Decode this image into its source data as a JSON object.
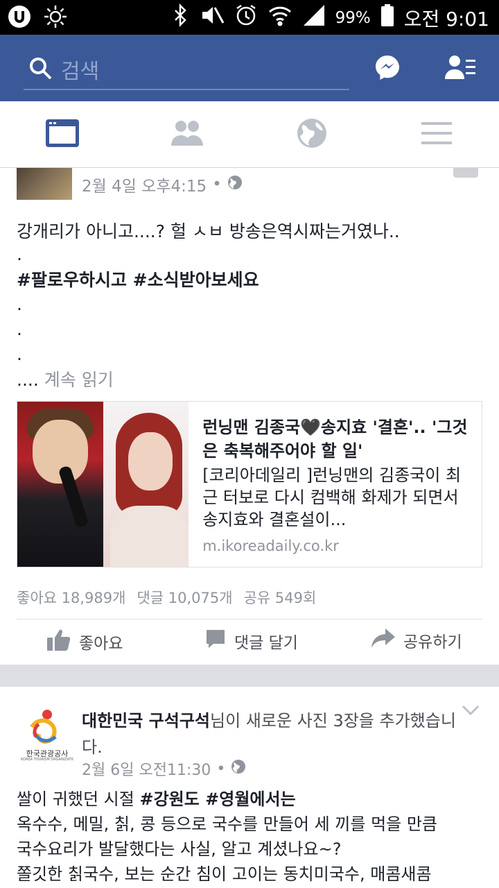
{
  "status_bar": {
    "battery": "99%",
    "time": "오전 9:01"
  },
  "header": {
    "search_placeholder": "검색"
  },
  "post1": {
    "time": "2월 4일 오후4:15",
    "line1": "강개리가 아니고....? 헐 ㅅㅂ 방송은역시짜는거였나..",
    "dot": ".",
    "hashtags": "#팔로우하시고 #소식받아보세요",
    "ellipsis": "....",
    "read_more": "계속 읽기",
    "link": {
      "title": "런닝맨 김종국🖤송지효 '결혼'.. '그것은 축복해주어야 할 일'",
      "description": "[코리아데일리 ]런닝맨의 김종국이 최근 터보로 다시 컴백해 화제가 되면서 송지효와 결혼설이...",
      "domain": "m.ikoreadaily.co.kr"
    },
    "likes": "좋아요 18,989개",
    "comments": "댓글 10,075개",
    "shares": "공유 549회",
    "like_label": "좋아요",
    "comment_label": "댓글 달기",
    "share_label": "공유하기"
  },
  "post2": {
    "page_name": "대한민국 구석구석",
    "action_text": "님이 새로운 사진 3장을 추가했습니다.",
    "logo_text": "한국관광공사",
    "logo_subtext": "KOREA TOURISM ORGANIZATION",
    "time": "2월 6일 오전11:30",
    "text_line1_a": "쌀이 귀했던 시절 ",
    "text_line1_b": "#강원도 #영월에서는",
    "text_line2": "옥수수, 메밀, 칡, 콩 등으로 국수를 만들어 세 끼를 먹을 만큼",
    "text_line3": "국수요리가 발달했다는 사실, 알고 계셨나요~?",
    "text_line4": "쫄깃한 칡국수, 보는 순간 침이 고이는 동치미국수, 매콤새콤"
  }
}
